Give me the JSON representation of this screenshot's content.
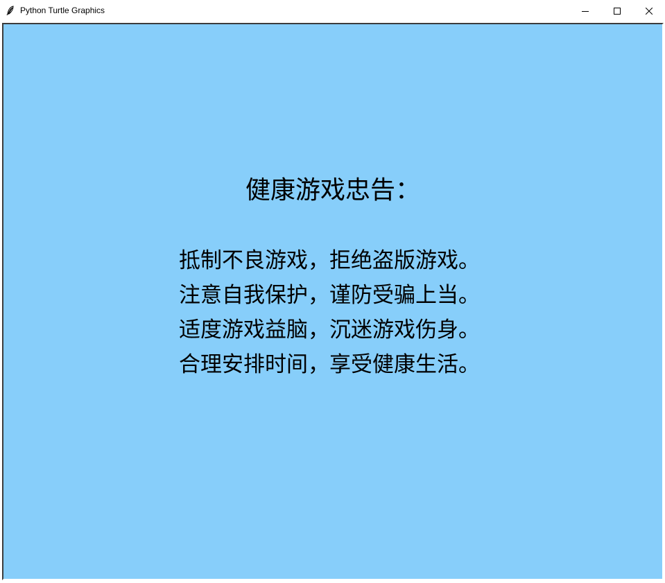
{
  "window": {
    "title": "Python Turtle Graphics",
    "app_icon": "feather-icon",
    "controls": {
      "minimize": "minimize-icon",
      "maximize": "maximize-icon",
      "close": "close-icon"
    }
  },
  "canvas": {
    "background": "#87cefa",
    "heading": "健康游戏忠告：",
    "lines": [
      "抵制不良游戏，拒绝盗版游戏。",
      "注意自我保护，谨防受骗上当。",
      "适度游戏益脑，沉迷游戏伤身。",
      "合理安排时间，享受健康生活。"
    ]
  }
}
